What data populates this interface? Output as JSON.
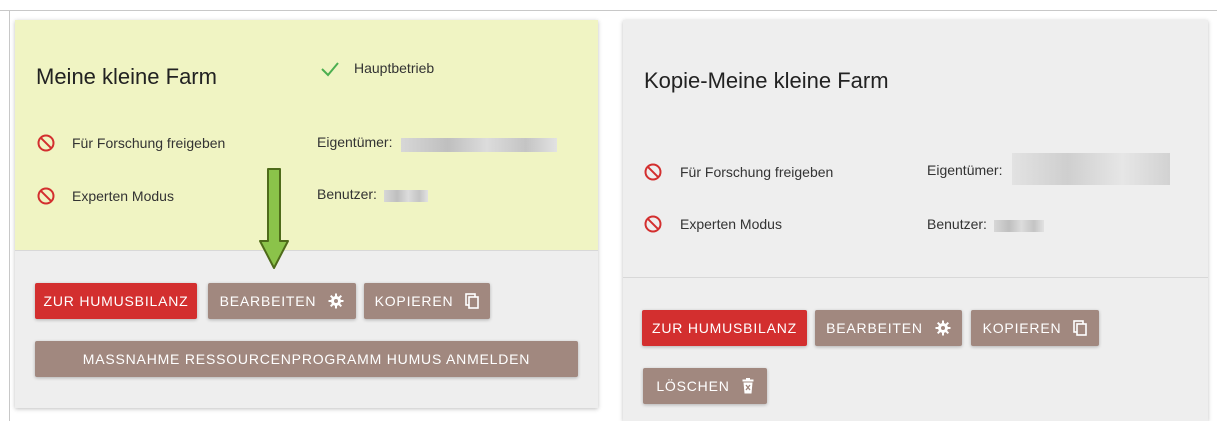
{
  "cards": [
    {
      "title": "Meine kleine Farm",
      "main_farm_label": "Hauptbetrieb",
      "research_label": "Für Forschung freigeben",
      "expert_label": "Experten Modus",
      "owner_label": "Eigentümer:",
      "user_label": "Benutzer:",
      "buttons": {
        "humus": "ZUR HUMUSBILANZ",
        "edit": "BEARBEITEN",
        "copy": "KOPIEREN",
        "register": "MASSNAHME RESSOURCENPROGRAMM HUMUS ANMELDEN"
      }
    },
    {
      "title": "Kopie-Meine kleine Farm",
      "research_label": "Für Forschung freigeben",
      "expert_label": "Experten Modus",
      "owner_label": "Eigentümer:",
      "user_label": "Benutzer:",
      "buttons": {
        "humus": "ZUR HUMUSBILANZ",
        "edit": "BEARBEITEN",
        "copy": "KOPIEREN",
        "delete": "LÖSCHEN"
      }
    }
  ],
  "colors": {
    "main_card_bg": "#f0f4c3",
    "card_bg": "#eeeeee",
    "primary_button": "#d32f2f",
    "secondary_button": "#a1887f",
    "check": "#4caf50",
    "blocked": "#d32f2f",
    "annotation_arrow": "#8bc34a"
  },
  "icons": [
    "check-icon",
    "block-icon",
    "gear-icon",
    "copy-icon",
    "trash-icon",
    "down-arrow-annotation"
  ]
}
